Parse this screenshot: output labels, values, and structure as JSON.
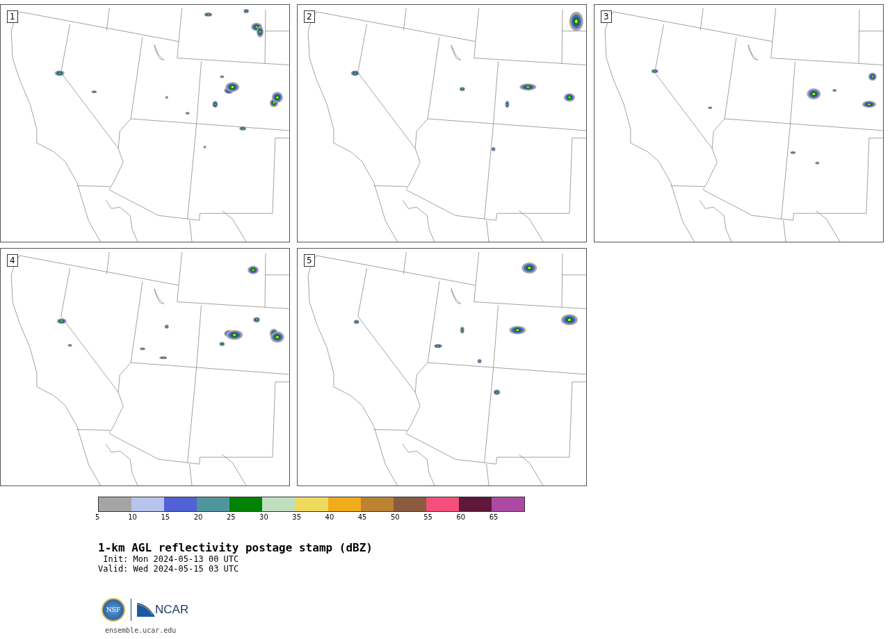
{
  "panels": [
    {
      "label": "1"
    },
    {
      "label": "2"
    },
    {
      "label": "3"
    },
    {
      "label": "4"
    },
    {
      "label": "5"
    }
  ],
  "colorbar": {
    "segments": [
      {
        "color": "#a5a5a5"
      },
      {
        "color": "#b8c4ee"
      },
      {
        "color": "#5161d6"
      },
      {
        "color": "#4f969c"
      },
      {
        "color": "#028202"
      },
      {
        "color": "#bfdfbf"
      },
      {
        "color": "#f0da5e"
      },
      {
        "color": "#f0ac19"
      },
      {
        "color": "#bb8332"
      },
      {
        "color": "#8b5a3f"
      },
      {
        "color": "#f54f7c"
      },
      {
        "color": "#601739"
      },
      {
        "color": "#ac4aa3"
      }
    ],
    "ticks": [
      "5",
      "10",
      "15",
      "20",
      "25",
      "30",
      "35",
      "40",
      "45",
      "50",
      "55",
      "60",
      "65"
    ]
  },
  "title": "1-km AGL reflectivity postage stamp (dBZ)",
  "init": " Init: Mon 2024-05-13 00 UTC",
  "valid": "Valid: Wed 2024-05-15 03 UTC",
  "logo": {
    "seal": "NSF",
    "wordmark": "NCAR"
  },
  "url": "ensemble.ucar.edu"
}
